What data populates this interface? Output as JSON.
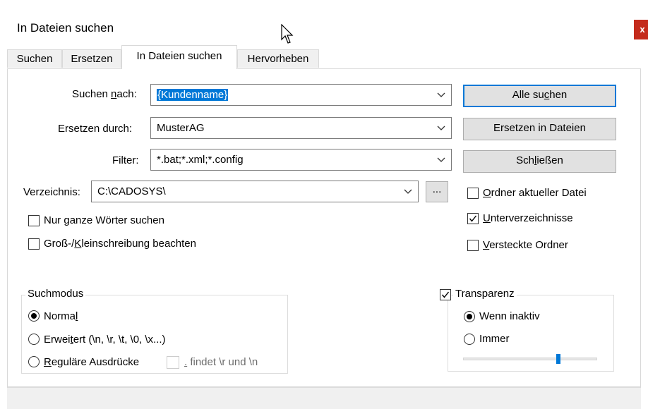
{
  "window": {
    "title": "In Dateien suchen",
    "close_symbol": "x"
  },
  "tabs": [
    {
      "label": "Suchen"
    },
    {
      "label": "Ersetzen"
    },
    {
      "label": "In Dateien suchen",
      "active": true
    },
    {
      "label": "Hervorheben"
    }
  ],
  "form": {
    "search_label_a": "Suchen ",
    "search_label_u": "n",
    "search_label_b": "ach:",
    "search_value": "{Kundenname}",
    "replace_label": "Ersetzen durch:",
    "replace_value": "MusterAG",
    "filter_label": "Filter:",
    "filter_value": "*.bat;*.xml;*.config",
    "directory_label": "Verzeichnis:",
    "directory_value": "C:\\CADOSYS\\",
    "browse_label": "..."
  },
  "options": {
    "whole_words_a": "Nur ",
    "whole_words_u": "g",
    "whole_words_b": "anze Wörter suchen",
    "whole_words_checked": false,
    "match_case_a": "Groß-/",
    "match_case_u": "K",
    "match_case_b": "leinschreibung beachten",
    "match_case_checked": false
  },
  "buttons": {
    "find_all_a": "Alle su",
    "find_all_u": "c",
    "find_all_b": "hen",
    "replace_in_files": "Ersetzen in Dateien",
    "close_a": "Sch",
    "close_u": "l",
    "close_b": "ießen"
  },
  "right_options": {
    "current_folder_u": "O",
    "current_folder_b": "rdner aktueller Datei",
    "current_folder_checked": false,
    "subdirs_u": "U",
    "subdirs_b": "nterverzeichnisse",
    "subdirs_checked": true,
    "hidden_u": "V",
    "hidden_b": "ersteckte Ordner",
    "hidden_checked": false
  },
  "search_mode": {
    "title": "Suchmodus",
    "normal_a": "Norma",
    "normal_u": "l",
    "normal_selected": true,
    "extended_a": "Erwei",
    "extended_u": "t",
    "extended_b": "ert (\\n, \\r, \\t, \\0, \\x...)",
    "regex_u": "R",
    "regex_b": "eguläre Ausdrücke",
    "dot_u": ".",
    "dot_b": " findet \\r und \\n"
  },
  "transparency": {
    "title": "Transparenz",
    "checked": true,
    "when_inactive": "Wenn inaktiv",
    "when_inactive_selected": true,
    "always": "Immer",
    "level_fraction": 0.72
  },
  "colors": {
    "accent": "#0078d7",
    "close": "#c42b1c"
  }
}
